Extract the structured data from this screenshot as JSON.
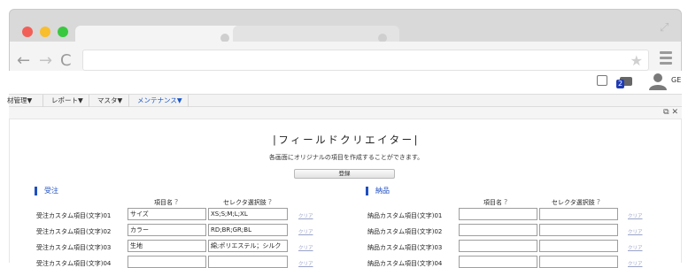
{
  "browser": {
    "expand_icon": "expand-icon",
    "nav": [
      "←",
      "→",
      "C"
    ],
    "star_icon": "★"
  },
  "appbar": {
    "badge_count": "2",
    "user_name": "GE"
  },
  "menubar": {
    "items": [
      "材管理▼",
      "レポート▼",
      "マスタ▼",
      "メンテナンス▼"
    ]
  },
  "strip": {
    "icons": "⧉ ✕"
  },
  "page": {
    "title": "|フィールドクリエイター|",
    "description": "各画面にオリジナルの項目を作成することができます。",
    "register_label": "登録"
  },
  "left": {
    "section": "受注",
    "col_name": "項目名",
    "col_options": "セレクタ選択肢",
    "help": "?",
    "rows": [
      {
        "label": "受注カスタム項目(文字)01",
        "name": "サイズ",
        "options": "XS;S;M;L;XL",
        "clear": "クリア"
      },
      {
        "label": "受注カスタム項目(文字)02",
        "name": "カラー",
        "options": "RD;BR;GR;BL",
        "clear": "クリア"
      },
      {
        "label": "受注カスタム項目(文字)03",
        "name": "生地",
        "options": "綿;ポリエステル；シルク",
        "clear": "クリア"
      },
      {
        "label": "受注カスタム項目(文字)04",
        "name": "",
        "options": "",
        "clear": "クリア"
      }
    ]
  },
  "right": {
    "section": "納品",
    "col_name": "項目名",
    "col_options": "セレクタ選択肢",
    "help": "?",
    "rows": [
      {
        "label": "納品カスタム項目(文字)01",
        "name": "",
        "options": "",
        "clear": "クリア"
      },
      {
        "label": "納品カスタム項目(文字)02",
        "name": "",
        "options": "",
        "clear": "クリア"
      },
      {
        "label": "納品カスタム項目(文字)03",
        "name": "",
        "options": "",
        "clear": "クリア"
      },
      {
        "label": "納品カスタム項目(文字)04",
        "name": "",
        "options": "",
        "clear": "クリア"
      }
    ]
  }
}
